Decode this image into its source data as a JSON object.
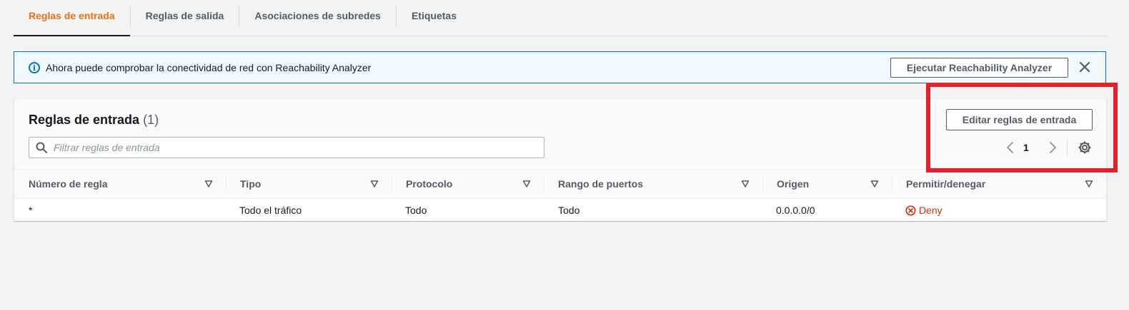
{
  "tabs": [
    {
      "label": "Reglas de entrada",
      "active": true
    },
    {
      "label": "Reglas de salida",
      "active": false
    },
    {
      "label": "Asociaciones de subredes",
      "active": false
    },
    {
      "label": "Etiquetas",
      "active": false
    }
  ],
  "banner": {
    "icon": "info-icon",
    "text": "Ahora puede comprobar la conectividad de red con Reachability Analyzer",
    "button_label": "Ejecutar Reachability Analyzer",
    "close_icon": "close-icon"
  },
  "panel": {
    "title": "Reglas de entrada",
    "count": "(1)",
    "search_placeholder": "Filtrar reglas de entrada",
    "edit_button_label": "Editar reglas de entrada",
    "page_number": "1"
  },
  "table": {
    "columns": [
      "Número de regla",
      "Tipo",
      "Protocolo",
      "Rango de puertos",
      "Origen",
      "Permitir/denegar"
    ],
    "rows": [
      {
        "rule_number": "*",
        "type": "Todo el tráfico",
        "protocol": "Todo",
        "port_range": "Todo",
        "source": "0.0.0.0/0",
        "action": "Deny"
      }
    ]
  },
  "colors": {
    "accent": "#ec7211",
    "info_blue": "#0073bb",
    "deny_red": "#d13212",
    "highlight_red": "#e5202a"
  }
}
